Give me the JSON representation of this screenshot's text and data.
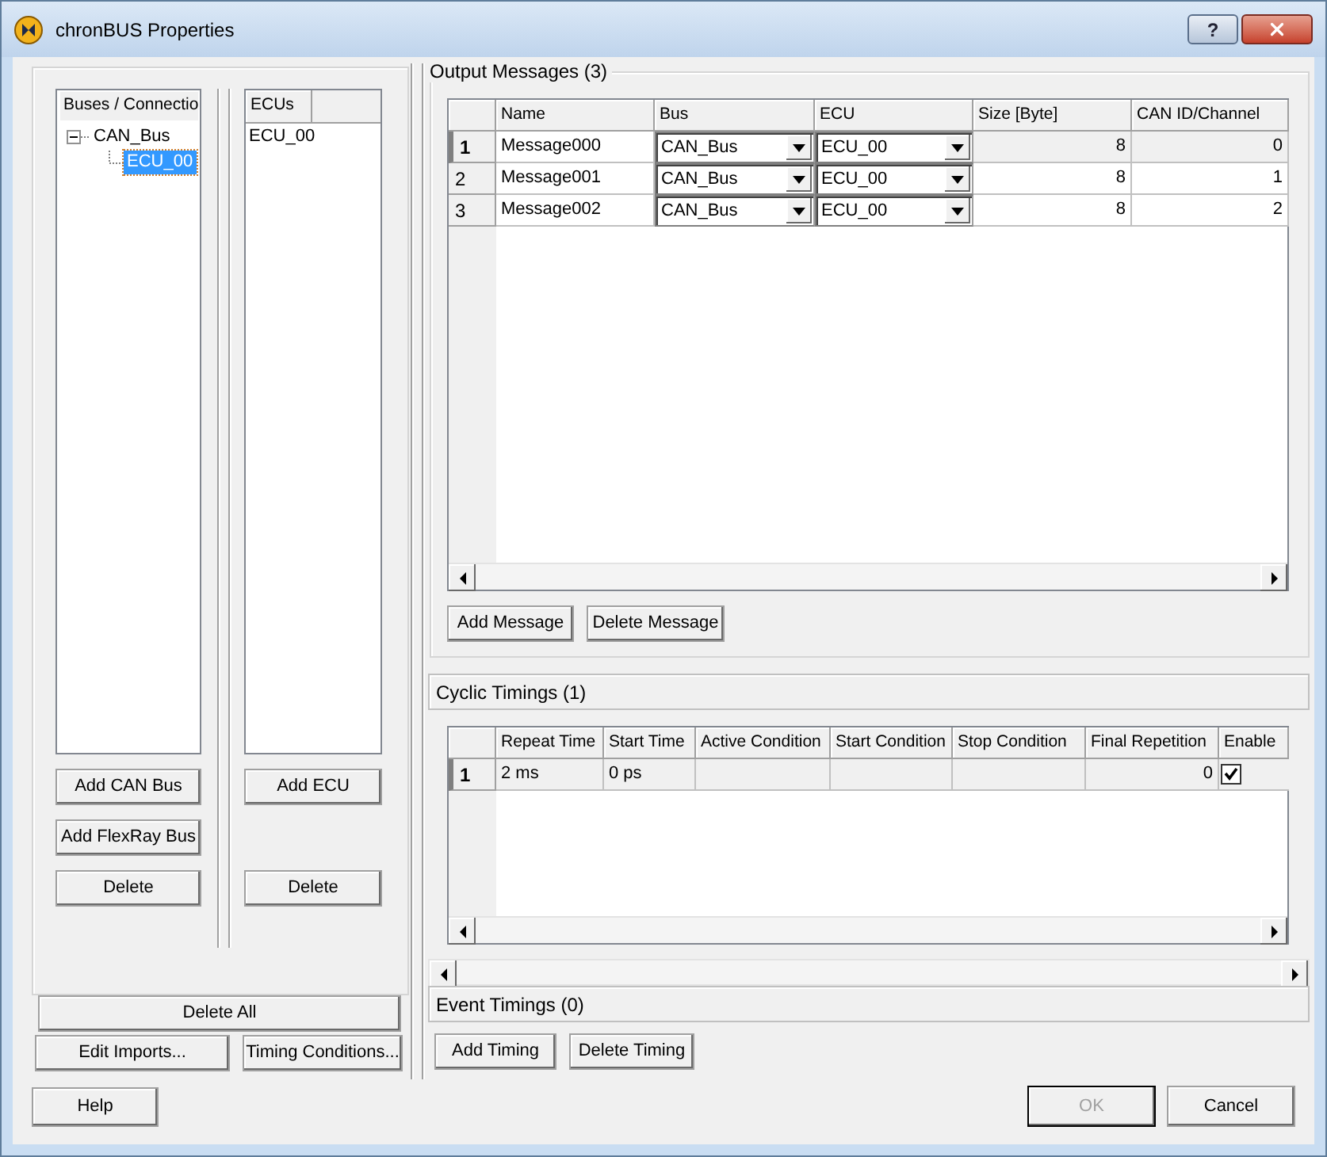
{
  "window": {
    "title": "chronBUS Properties",
    "help_glyph": "?"
  },
  "buses_panel": {
    "header": "Buses / Connectio",
    "tree": [
      {
        "label": "CAN_Bus",
        "expanded": true,
        "selected": false,
        "children": [
          {
            "label": "ECU_00",
            "selected": true
          }
        ]
      }
    ],
    "buttons": [
      "Add CAN Bus",
      "Add FlexRay Bus",
      "Delete"
    ]
  },
  "ecus_panel": {
    "header": "ECUs",
    "items": [
      {
        "label": "ECU_00",
        "selected": false
      }
    ],
    "buttons": [
      "Add ECU",
      "Delete"
    ]
  },
  "delete_all_button": "Delete All",
  "left_buttons": [
    "Edit Imports...",
    "Timing Conditions..."
  ],
  "help_button": "Help",
  "output_messages": {
    "title": "Output Messages (3)",
    "columns": [
      "Name",
      "Bus",
      "ECU",
      "Size [Byte]",
      "CAN ID/Channel"
    ],
    "rows": [
      {
        "index": "1",
        "selected": true,
        "name": "Message000",
        "bus": "CAN_Bus",
        "ecu": "ECU_00",
        "size": "8",
        "can_id": "0"
      },
      {
        "index": "2",
        "selected": false,
        "name": "Message001",
        "bus": "CAN_Bus",
        "ecu": "ECU_00",
        "size": "8",
        "can_id": "1"
      },
      {
        "index": "3",
        "selected": false,
        "name": "Message002",
        "bus": "CAN_Bus",
        "ecu": "ECU_00",
        "size": "8",
        "can_id": "2"
      }
    ],
    "buttons": [
      "Add Message",
      "Delete Message"
    ]
  },
  "cyclic_timings": {
    "title": "Cyclic Timings (1)",
    "columns": [
      "Repeat Time",
      "Start Time",
      "Active Condition",
      "Start Condition",
      "Stop Condition",
      "Final Repetition",
      "Enable"
    ],
    "rows": [
      {
        "index": "1",
        "selected": true,
        "repeat_time": "2 ms",
        "start_time": "0 ps",
        "final_repetition": "0",
        "enable": true
      }
    ]
  },
  "event_timings": {
    "title": "Event Timings (0)"
  },
  "timing_buttons": [
    "Add Timing",
    "Delete Timing"
  ],
  "dialog_buttons": [
    {
      "label": "OK",
      "disabled": true,
      "default": true
    },
    {
      "label": "Cancel",
      "disabled": false,
      "default": false
    }
  ]
}
